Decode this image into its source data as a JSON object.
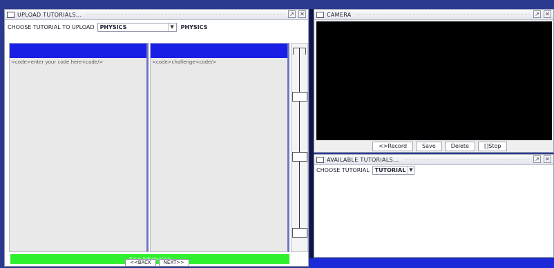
{
  "upload_window": {
    "title": "UPLOAD TUTORIALS...",
    "choose_label": "CHOOSE TUTORIAL TO UPLOAD",
    "choose_value": "PHYSICS",
    "subject_label": "PHYSICS",
    "code_panel_text": "<code>enter your code here<code/>",
    "challenge_panel_text": "<code>challenge<code/>",
    "save_label": "Save Information",
    "back_label": "<<BACK",
    "next_label": "NEXT>>"
  },
  "camera_window": {
    "title": "CAMERA",
    "buttons": [
      "<>Record",
      "Save",
      "Delete",
      "[]Stop"
    ]
  },
  "tutorials_window": {
    "title": "AVAILABLE TUTORIALS...",
    "choose_label": "CHOOSE TUTORIAL",
    "choose_value": "TUTORIAL"
  },
  "icons": {
    "window": "window-icon",
    "maximize": "maximize-icon",
    "close": "close-icon",
    "dropdown": "chevron-down-icon"
  },
  "colors": {
    "panel_header": "#1a1fe6",
    "save_bar": "#2ef02e",
    "camera_view": "#000000"
  }
}
